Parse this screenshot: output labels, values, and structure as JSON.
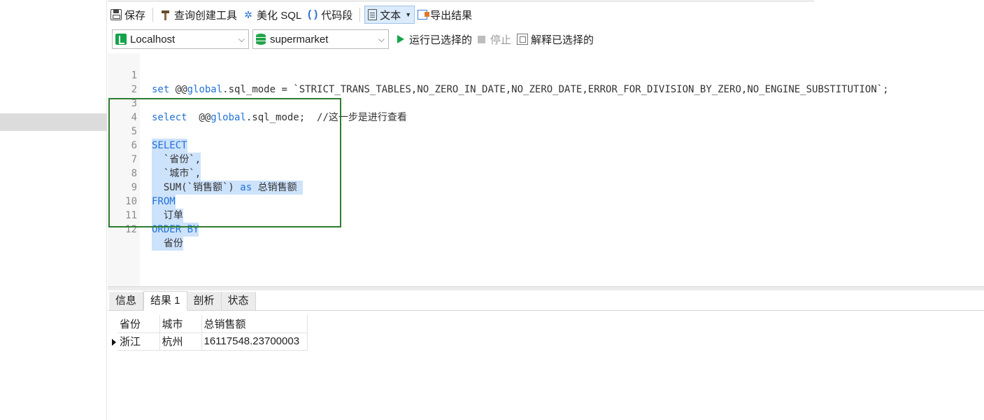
{
  "toolbar": {
    "save": "保存",
    "query_builder": "查询创建工具",
    "beautify_sql": "美化 SQL",
    "code_snippet": "代码段",
    "text": "文本",
    "export": "导出结果"
  },
  "connection": {
    "server": "Localhost",
    "database": "supermarket",
    "run_selected": "运行已选择的",
    "stop": "停止",
    "explain_selected": "解释已选择的"
  },
  "editor": {
    "lines": [
      {
        "num": "1",
        "text": "set @@global.sql_mode = `STRICT_TRANS_TABLES,NO_ZERO_IN_DATE,NO_ZERO_DATE,ERROR_FOR_DIVISION_BY_ZERO,NO_ENGINE_SUBSTITUTION`;"
      },
      {
        "num": "2",
        "text": ""
      },
      {
        "num": "3",
        "text": "select  @@global.sql_mode;  //这一步是进行查看"
      },
      {
        "num": "4",
        "text": ""
      },
      {
        "num": "5",
        "text": "SELECT"
      },
      {
        "num": "6",
        "text": "  `省份`,"
      },
      {
        "num": "7",
        "text": "  `城市`,"
      },
      {
        "num": "8",
        "text": "  SUM(`销售额`) as 总销售额"
      },
      {
        "num": "9",
        "text": "FROM"
      },
      {
        "num": "10",
        "text": "  订单"
      },
      {
        "num": "11",
        "text": "ORDER BY"
      },
      {
        "num": "12",
        "text": "  省份"
      }
    ]
  },
  "result_tabs": [
    "信息",
    "结果 1",
    "剖析",
    "状态"
  ],
  "result": {
    "columns": [
      "省份",
      "城市",
      "总销售额"
    ],
    "rows": [
      [
        "浙江",
        "杭州",
        "16117548.23700003"
      ]
    ]
  },
  "colors": {
    "keyword": "#2272d6",
    "selection": "#cde2fb",
    "highlight_box": "#2e7d32",
    "run_icon": "#16a34a"
  }
}
